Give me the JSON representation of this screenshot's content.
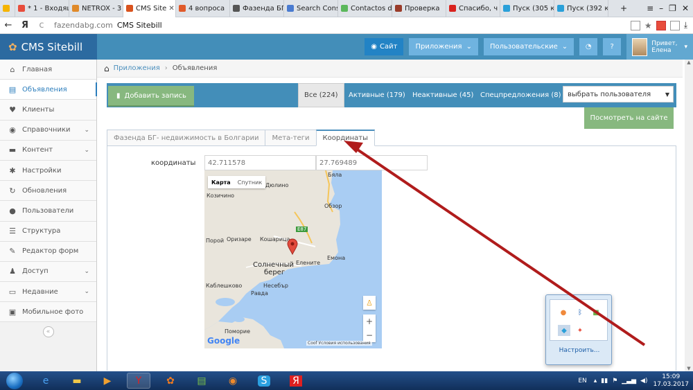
{
  "browser": {
    "tabs": [
      {
        "label": "",
        "color": "#f5b400"
      },
      {
        "label": "* 1 - Входящ",
        "color": "#e84d3c"
      },
      {
        "label": "NETROX - 3",
        "color": "#e08a2a"
      },
      {
        "label": "CMS Site",
        "color": "#d9531e"
      },
      {
        "label": "4 вопроса",
        "color": "#e05a2a"
      },
      {
        "label": "Фазенда БГ",
        "color": "#555555"
      },
      {
        "label": "Search Cons",
        "color": "#4a7bd0"
      },
      {
        "label": "Contactos d",
        "color": "#5cb85c"
      },
      {
        "label": "Проверка",
        "color": "#9a3c2a"
      },
      {
        "label": "Спасибо, ч",
        "color": "#d9221e"
      },
      {
        "label": "Пуск (305 к",
        "color": "#2aa0d9"
      },
      {
        "label": "Пуск (392 к",
        "color": "#2aa0d9"
      }
    ],
    "new_tab": "+",
    "controls": [
      "≡",
      "–",
      "❐",
      "✕"
    ],
    "back": "←",
    "ya": "Я",
    "reload": "c",
    "domain": "fazendabg.com",
    "page_title": "CMS Sitebill",
    "download": "⤓"
  },
  "header": {
    "brand": "CMS Sitebill",
    "site_btn": "Сайт",
    "apps_btn": "Приложения",
    "custom_btn": "Пользовательские",
    "user_greeting": "Привет,",
    "user_name": "Елена"
  },
  "sidebar": {
    "items": [
      {
        "label": "Главная",
        "icon": "⌂",
        "chev": ""
      },
      {
        "label": "Объявления",
        "icon": "▤",
        "chev": ""
      },
      {
        "label": "Клиенты",
        "icon": "♥",
        "chev": ""
      },
      {
        "label": "Справочники",
        "icon": "◉",
        "chev": "⌄"
      },
      {
        "label": "Контент",
        "icon": "▬",
        "chev": "⌄"
      },
      {
        "label": "Настройки",
        "icon": "✱",
        "chev": ""
      },
      {
        "label": "Обновления",
        "icon": "↻",
        "chev": ""
      },
      {
        "label": "Пользователи",
        "icon": "●",
        "chev": ""
      },
      {
        "label": "Структура",
        "icon": "☰",
        "chev": ""
      },
      {
        "label": "Редактор форм",
        "icon": "✎",
        "chev": ""
      },
      {
        "label": "Доступ",
        "icon": "♟",
        "chev": "⌄"
      },
      {
        "label": "Недавние",
        "icon": "▭",
        "chev": "⌄"
      },
      {
        "label": "Мобильное фото",
        "icon": "▣",
        "chev": ""
      }
    ],
    "collapse": "«"
  },
  "breadcrumbs": {
    "home": "⌂",
    "items": [
      "Приложения",
      "Объявления"
    ],
    "sep": "›"
  },
  "toolbar": {
    "add": "Добавить запись",
    "filters": [
      "Все (224)",
      "Активные (179)",
      "Неактивные (45)",
      "Спецпредложения (8)"
    ],
    "user_select": "выбрать пользователя",
    "view_site": "Посмотреть на сайте"
  },
  "panel": {
    "tabs": [
      "Фазенда БГ- недвижимость в Болгарии",
      "Мета-теги",
      "Координаты"
    ],
    "coords_label": "координаты",
    "lat": "42.711578",
    "lng": "27.769489"
  },
  "map": {
    "map_btn": "Карта",
    "sat_btn": "Спутник",
    "labels": [
      "Дюлино",
      "Бяла",
      "Козичино",
      "Обзор",
      "Порой",
      "Оризаре",
      "Кошарица",
      "Солнечный",
      "берег",
      "Елените",
      "Емона",
      "Несебър",
      "Каблешково",
      "Равда",
      "Поморие"
    ],
    "road": "E87",
    "google": "Google",
    "terms": "Coof  Условия использования",
    "zoom_in": "+",
    "zoom_out": "−",
    "pegman": "♙"
  },
  "tray": {
    "configure": "Настроить..."
  },
  "taskbar": {
    "lang": "EN",
    "time": "15:09",
    "date": "17.03.2017"
  },
  "colors": {
    "accent": "#438eb9",
    "green": "#87b87f",
    "arrow": "#b01c1c"
  }
}
